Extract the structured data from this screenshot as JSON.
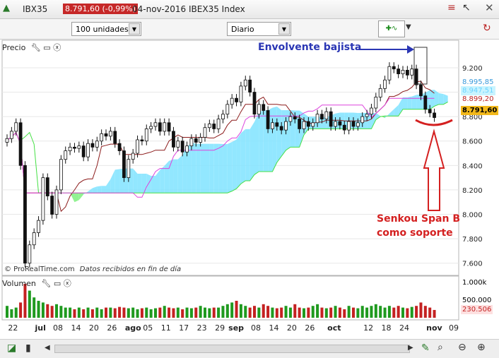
{
  "header": {
    "symbol": "IBX35",
    "price_change": "8.791,60 (-0,99%)",
    "date_instrument": "04-nov-2016 IBEX35 Index"
  },
  "toolbar": {
    "units": "100 unidades",
    "period": "Diario"
  },
  "panels": {
    "price_label": "Precio",
    "volume_label": "Volumen",
    "watermark": "© ProRealTime.com",
    "status": "Datos recibidos en fin de día"
  },
  "price_boxes": {
    "p1": "8.995,85",
    "p2": "8.947,51",
    "p3": "8.899,20",
    "last": "8.791,60"
  },
  "volume_boxes": {
    "v1": "500.000",
    "v_last": "230.506"
  },
  "annotations": {
    "envolvente": "Envolvente bajista",
    "senkou_line1": "Senkou Span B",
    "senkou_line2": "como soporte"
  },
  "colors": {
    "candle": "#111111",
    "tenkan": "#8b1a1a",
    "kijun": "#dd44dd",
    "senkou_up": "#44e044",
    "cloud_bull": "#7fe3ff",
    "cloud_bear": "#7ef07e",
    "annotation_red": "#d42020",
    "annotation_blue": "#2a36b4",
    "volume_up": "#1f9a1f",
    "volume_down": "#c42121"
  },
  "chart_data": {
    "type": "candlestick",
    "title": "04-nov-2016 IBEX35 Index",
    "y_ticks": [
      "9.200",
      "9.000",
      "8.800",
      "8.600",
      "8.400",
      "8.200",
      "8.000",
      "7.800",
      "7.600"
    ],
    "ylim": [
      7500,
      9350
    ],
    "volume_ticks": [
      "1.000k",
      "500.000"
    ],
    "x_labels": [
      {
        "label": "22",
        "i": 1
      },
      {
        "label": "jul",
        "i": 7
      },
      {
        "label": "08",
        "i": 11
      },
      {
        "label": "14",
        "i": 15
      },
      {
        "label": "20",
        "i": 19
      },
      {
        "label": "26",
        "i": 23
      },
      {
        "label": "ago",
        "i": 27
      },
      {
        "label": "05",
        "i": 31
      },
      {
        "label": "11",
        "i": 35
      },
      {
        "label": "17",
        "i": 39
      },
      {
        "label": "23",
        "i": 43
      },
      {
        "label": "29",
        "i": 47
      },
      {
        "label": "sep",
        "i": 50
      },
      {
        "label": "08",
        "i": 55
      },
      {
        "label": "14",
        "i": 59
      },
      {
        "label": "20",
        "i": 63
      },
      {
        "label": "26",
        "i": 67
      },
      {
        "label": "oct",
        "i": 72
      },
      {
        "label": "12",
        "i": 80
      },
      {
        "label": "18",
        "i": 84
      },
      {
        "label": "24",
        "i": 88
      },
      {
        "label": "nov",
        "i": 94
      },
      {
        "label": "09",
        "i": 99
      }
    ],
    "close": [
      8620,
      8680,
      8750,
      8400,
      7600,
      7750,
      7850,
      7950,
      8300,
      8150,
      8000,
      8200,
      8450,
      8520,
      8550,
      8540,
      8560,
      8470,
      8580,
      8550,
      8600,
      8660,
      8640,
      8680,
      8580,
      8520,
      8300,
      8450,
      8500,
      8610,
      8600,
      8700,
      8720,
      8750,
      8680,
      8750,
      8680,
      8550,
      8600,
      8510,
      8560,
      8620,
      8590,
      8630,
      8710,
      8740,
      8700,
      8780,
      8820,
      8900,
      8950,
      8920,
      9050,
      9100,
      9000,
      8820,
      8900,
      8850,
      8700,
      8750,
      8720,
      8690,
      8760,
      8800,
      8780,
      8700,
      8760,
      8720,
      8750,
      8820,
      8780,
      8840,
      8720,
      8760,
      8730,
      8690,
      8760,
      8720,
      8750,
      8800,
      8820,
      8870,
      8960,
      9030,
      9100,
      9210,
      9190,
      9150,
      9180,
      9140,
      9190,
      9060,
      8970,
      8860,
      8830,
      8792
    ],
    "volume": [
      0.35,
      0.25,
      0.3,
      0.45,
      1.0,
      0.8,
      0.6,
      0.5,
      0.45,
      0.4,
      0.35,
      0.4,
      0.35,
      0.3,
      0.3,
      0.25,
      0.3,
      0.25,
      0.3,
      0.25,
      0.3,
      0.25,
      0.3,
      0.3,
      0.28,
      0.32,
      0.3,
      0.28,
      0.3,
      0.25,
      0.28,
      0.3,
      0.25,
      0.28,
      0.3,
      0.35,
      0.3,
      0.28,
      0.3,
      0.25,
      0.3,
      0.28,
      0.3,
      0.35,
      0.3,
      0.28,
      0.3,
      0.3,
      0.35,
      0.4,
      0.45,
      0.5,
      0.4,
      0.35,
      0.3,
      0.35,
      0.3,
      0.4,
      0.35,
      0.3,
      0.28,
      0.3,
      0.35,
      0.3,
      0.4,
      0.3,
      0.28,
      0.3,
      0.35,
      0.4,
      0.3,
      0.28,
      0.3,
      0.35,
      0.3,
      0.25,
      0.35,
      0.3,
      0.28,
      0.35,
      0.3,
      0.35,
      0.4,
      0.35,
      0.3,
      0.35,
      0.3,
      0.35,
      0.3,
      0.28,
      0.32,
      0.35,
      0.45,
      0.35,
      0.3,
      0.23
    ]
  }
}
